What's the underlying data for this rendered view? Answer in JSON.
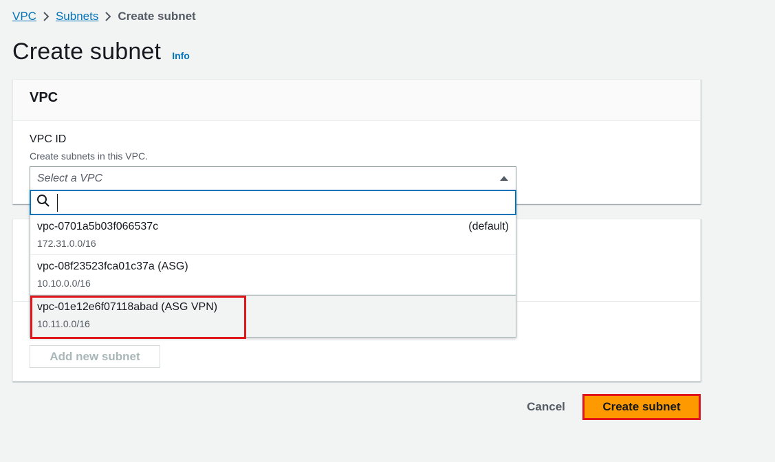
{
  "breadcrumb": {
    "items": [
      {
        "label": "VPC"
      },
      {
        "label": "Subnets"
      },
      {
        "label": "Create subnet"
      }
    ]
  },
  "header": {
    "title": "Create subnet",
    "info": "Info"
  },
  "vpc_panel": {
    "heading": "VPC",
    "field_label": "VPC ID",
    "field_description": "Create subnets in this VPC.",
    "select_placeholder": "Select a VPC",
    "search_value": "",
    "options": [
      {
        "id": "vpc-0701a5b03f066537c",
        "tag": "(default)",
        "cidr": "172.31.0.0/16"
      },
      {
        "id": "vpc-08f23523fca01c37a (ASG)",
        "tag": "",
        "cidr": "10.10.0.0/16"
      },
      {
        "id": "vpc-01e12e6f07118abad (ASG VPN)",
        "tag": "",
        "cidr": "10.11.0.0/16"
      }
    ]
  },
  "subnet_panel": {
    "add_button": "Add new subnet"
  },
  "footer": {
    "cancel": "Cancel",
    "create": "Create subnet"
  },
  "colors": {
    "link": "#0073bb",
    "primary_button": "#ff9900",
    "highlight_border": "#e0161b",
    "focus_border": "#0073bb"
  }
}
